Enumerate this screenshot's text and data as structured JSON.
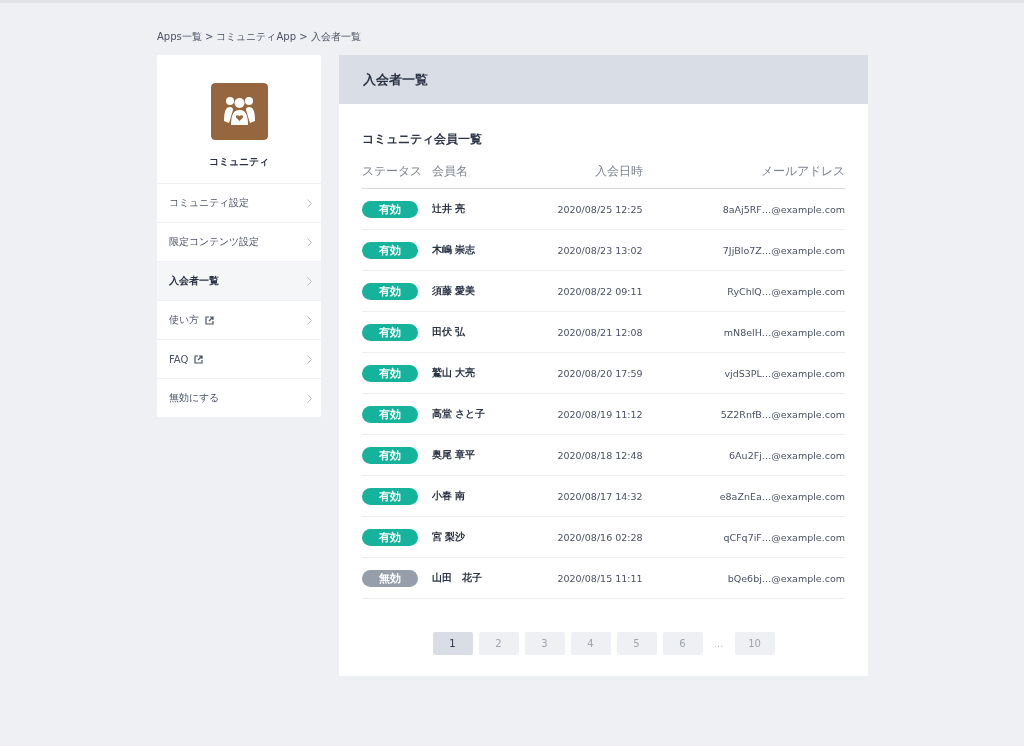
{
  "breadcrumb": "Apps一覧 > コミュニティApp > 入会者一覧",
  "sidebar": {
    "app_name": "コミュニティ",
    "items": [
      {
        "label": "コミュニティ設定",
        "external": false,
        "selected": false
      },
      {
        "label": "限定コンテンツ設定",
        "external": false,
        "selected": false
      },
      {
        "label": "入会者一覧",
        "external": false,
        "selected": true
      },
      {
        "label": "使い方",
        "external": true,
        "selected": false
      },
      {
        "label": "FAQ",
        "external": true,
        "selected": false
      },
      {
        "label": "無効にする",
        "external": false,
        "selected": false
      }
    ]
  },
  "page_title": "入会者一覧",
  "section_title": "コミュニティ会員一覧",
  "table": {
    "columns": [
      "ステータス",
      "会員名",
      "入会日時",
      "メールアドレス"
    ],
    "rows": [
      {
        "status": "有効",
        "active": true,
        "name": "辻井 亮",
        "joined": "2020/08/25 12:25",
        "email": "8aAj5RF…@example.com"
      },
      {
        "status": "有効",
        "active": true,
        "name": "木嶋 崇志",
        "joined": "2020/08/23 13:02",
        "email": "7JjBlo7Z…@example.com"
      },
      {
        "status": "有効",
        "active": true,
        "name": "須藤 愛美",
        "joined": "2020/08/22 09:11",
        "email": "RyChlQ…@example.com"
      },
      {
        "status": "有効",
        "active": true,
        "name": "田伏 弘",
        "joined": "2020/08/21 12:08",
        "email": "mN8elH…@example.com"
      },
      {
        "status": "有効",
        "active": true,
        "name": "鷲山 大亮",
        "joined": "2020/08/20 17:59",
        "email": "vjdS3PL…@example.com"
      },
      {
        "status": "有効",
        "active": true,
        "name": "高堂 さと子",
        "joined": "2020/08/19 11:12",
        "email": "5Z2RnfB…@example.com"
      },
      {
        "status": "有効",
        "active": true,
        "name": "奥尾 章平",
        "joined": "2020/08/18 12:48",
        "email": "6Au2Fj…@example.com"
      },
      {
        "status": "有効",
        "active": true,
        "name": "小春 南",
        "joined": "2020/08/17 14:32",
        "email": "e8aZnEa…@example.com"
      },
      {
        "status": "有効",
        "active": true,
        "name": "宮 梨沙",
        "joined": "2020/08/16 02:28",
        "email": "qCFq7iF…@example.com"
      },
      {
        "status": "無効",
        "active": false,
        "name": "山田　花子",
        "joined": "2020/08/15 11:11",
        "email": "bQe6bj…@example.com"
      }
    ]
  },
  "pagination": [
    {
      "kind": "page",
      "label": "1",
      "selected": true
    },
    {
      "kind": "page",
      "label": "2",
      "selected": false
    },
    {
      "kind": "page",
      "label": "3",
      "selected": false
    },
    {
      "kind": "page",
      "label": "4",
      "selected": false
    },
    {
      "kind": "page",
      "label": "5",
      "selected": false
    },
    {
      "kind": "page",
      "label": "6",
      "selected": false
    },
    {
      "kind": "gap",
      "label": "…"
    },
    {
      "kind": "page",
      "label": "10",
      "selected": false
    }
  ]
}
